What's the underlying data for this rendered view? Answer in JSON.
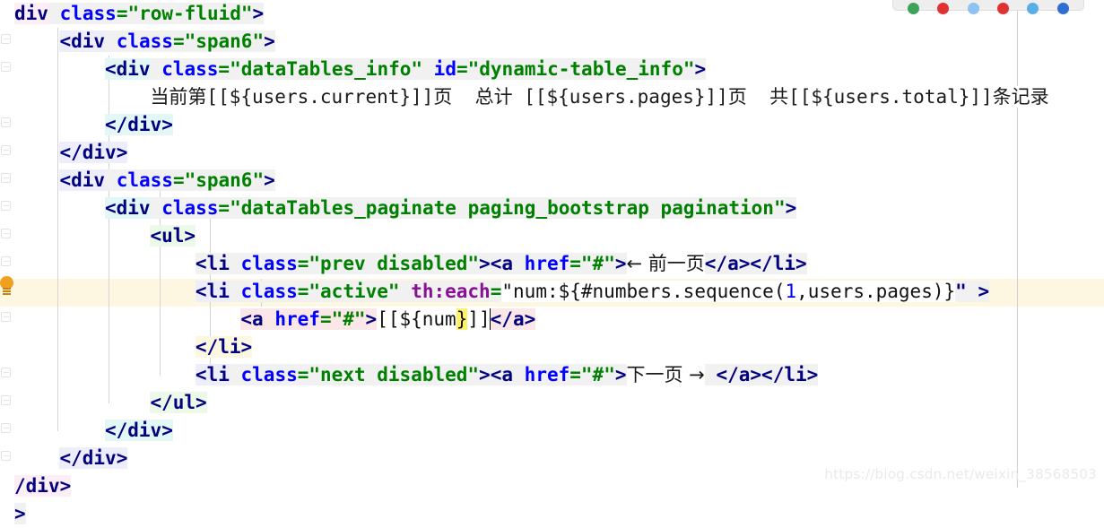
{
  "editor": {
    "title": "IntelliJ IDEA HTML/Thymeleaf template editor",
    "current_line_number": 11,
    "caret_line_index": 10,
    "colors": {
      "tag": "#000080",
      "attribute": "#0000ff",
      "attribute_value": "#008000",
      "namespaced_attribute": "#871094",
      "current_line_background": "#fdf6e0",
      "matching_brace_background": "#fdf06a",
      "background": "#ffffff",
      "guide": "#cfcfcf",
      "bulb": "#f0a01e"
    },
    "lines": [
      {
        "indent": 0,
        "tokens": [
          {
            "t": "div",
            "c": "tag",
            "bg": "bg-pink"
          },
          {
            "t": " ",
            "c": "plain",
            "bg": "bg-grey"
          },
          {
            "t": "class",
            "c": "attr",
            "bg": "bg-grey"
          },
          {
            "t": "=",
            "c": "eq",
            "bg": "bg-grey"
          },
          {
            "t": "\"row-fluid\"",
            "c": "val",
            "bg": "bg-grey"
          },
          {
            "t": ">",
            "c": "pct",
            "bg": "bg-grey"
          }
        ]
      },
      {
        "indent": 1,
        "tokens": [
          {
            "t": "<",
            "c": "pct",
            "bg": "bg-lav"
          },
          {
            "t": "div",
            "c": "tag",
            "bg": "bg-lav"
          },
          {
            "t": " ",
            "c": "plain",
            "bg": "bg-grey"
          },
          {
            "t": "class",
            "c": "attr",
            "bg": "bg-grey"
          },
          {
            "t": "=",
            "c": "eq",
            "bg": "bg-grey"
          },
          {
            "t": "\"span6\"",
            "c": "val",
            "bg": "bg-grey"
          },
          {
            "t": ">",
            "c": "pct",
            "bg": "bg-grey"
          }
        ]
      },
      {
        "indent": 2,
        "tokens": [
          {
            "t": "<",
            "c": "pct",
            "bg": "bg-cyan"
          },
          {
            "t": "div",
            "c": "tag",
            "bg": "bg-cyan"
          },
          {
            "t": " ",
            "c": "plain",
            "bg": "bg-grey"
          },
          {
            "t": "class",
            "c": "attr",
            "bg": "bg-grey"
          },
          {
            "t": "=",
            "c": "eq",
            "bg": "bg-grey"
          },
          {
            "t": "\"dataTables_info\"",
            "c": "val",
            "bg": "bg-grey"
          },
          {
            "t": " ",
            "c": "plain",
            "bg": "bg-grey"
          },
          {
            "t": "id",
            "c": "attr",
            "bg": "bg-grey"
          },
          {
            "t": "=",
            "c": "eq",
            "bg": "bg-grey"
          },
          {
            "t": "\"dynamic-table_info\"",
            "c": "val",
            "bg": "bg-grey"
          },
          {
            "t": ">",
            "c": "pct",
            "bg": "bg-grey"
          }
        ]
      },
      {
        "indent": 3,
        "cjk": true,
        "tokens": [
          {
            "t": "当前第[[${users.current}]]页  总计 [[${users.pages}]]页  共[[${users.total}]]条记录",
            "c": "plain",
            "bg": "bg-white"
          }
        ]
      },
      {
        "indent": 2,
        "tokens": [
          {
            "t": "</",
            "c": "pct",
            "bg": "bg-cyan"
          },
          {
            "t": "div",
            "c": "tag",
            "bg": "bg-cyan"
          },
          {
            "t": ">",
            "c": "pct",
            "bg": "bg-cyan"
          }
        ]
      },
      {
        "indent": 1,
        "tokens": [
          {
            "t": "</",
            "c": "pct",
            "bg": "bg-lav"
          },
          {
            "t": "div",
            "c": "tag",
            "bg": "bg-lav"
          },
          {
            "t": ">",
            "c": "pct",
            "bg": "bg-lav"
          }
        ]
      },
      {
        "indent": 1,
        "tokens": [
          {
            "t": "<",
            "c": "pct",
            "bg": "bg-lav"
          },
          {
            "t": "div",
            "c": "tag",
            "bg": "bg-lav"
          },
          {
            "t": " ",
            "c": "plain",
            "bg": "bg-grey"
          },
          {
            "t": "class",
            "c": "attr",
            "bg": "bg-grey"
          },
          {
            "t": "=",
            "c": "eq",
            "bg": "bg-grey"
          },
          {
            "t": "\"span6\"",
            "c": "val",
            "bg": "bg-grey"
          },
          {
            "t": ">",
            "c": "pct",
            "bg": "bg-grey"
          }
        ]
      },
      {
        "indent": 2,
        "tokens": [
          {
            "t": "<",
            "c": "pct",
            "bg": "bg-cyan"
          },
          {
            "t": "div",
            "c": "tag",
            "bg": "bg-cyan"
          },
          {
            "t": " ",
            "c": "plain",
            "bg": "bg-grey"
          },
          {
            "t": "class",
            "c": "attr",
            "bg": "bg-grey"
          },
          {
            "t": "=",
            "c": "eq",
            "bg": "bg-grey"
          },
          {
            "t": "\"dataTables_paginate paging_bootstrap pagination\"",
            "c": "val",
            "bg": "bg-grey"
          },
          {
            "t": ">",
            "c": "pct",
            "bg": "bg-grey"
          }
        ]
      },
      {
        "indent": 3,
        "tokens": [
          {
            "t": "<",
            "c": "pct",
            "bg": "bg-green"
          },
          {
            "t": "ul",
            "c": "tag",
            "bg": "bg-green"
          },
          {
            "t": ">",
            "c": "pct",
            "bg": "bg-green"
          }
        ]
      },
      {
        "indent": 4,
        "cjk_mix": true,
        "tokens": [
          {
            "t": "<",
            "c": "pct",
            "bg": "bg-grey"
          },
          {
            "t": "li",
            "c": "tag",
            "bg": "bg-grey"
          },
          {
            "t": " ",
            "c": "plain",
            "bg": "bg-grey"
          },
          {
            "t": "class",
            "c": "attr",
            "bg": "bg-grey"
          },
          {
            "t": "=",
            "c": "eq",
            "bg": "bg-grey"
          },
          {
            "t": "\"prev disabled\"",
            "c": "val",
            "bg": "bg-grey"
          },
          {
            "t": ">",
            "c": "pct",
            "bg": "bg-grey"
          },
          {
            "t": "<",
            "c": "pct",
            "bg": "bg-grey"
          },
          {
            "t": "a",
            "c": "tag",
            "bg": "bg-grey"
          },
          {
            "t": " ",
            "c": "plain",
            "bg": "bg-grey"
          },
          {
            "t": "href",
            "c": "attr",
            "bg": "bg-grey"
          },
          {
            "t": "=",
            "c": "eq",
            "bg": "bg-grey"
          },
          {
            "t": "\"#\"",
            "c": "val",
            "bg": "bg-grey"
          },
          {
            "t": ">",
            "c": "pct",
            "bg": "bg-grey"
          },
          {
            "t": "← 前一页",
            "c": "cjk",
            "bg": "bg-white"
          },
          {
            "t": "</",
            "c": "pct",
            "bg": "bg-grey"
          },
          {
            "t": "a",
            "c": "tag",
            "bg": "bg-grey"
          },
          {
            "t": ">",
            "c": "pct",
            "bg": "bg-grey"
          },
          {
            "t": "</",
            "c": "pct",
            "bg": "bg-grey"
          },
          {
            "t": "li",
            "c": "tag",
            "bg": "bg-grey"
          },
          {
            "t": ">",
            "c": "pct",
            "bg": "bg-grey"
          }
        ]
      },
      {
        "indent": 4,
        "tokens": [
          {
            "t": "<",
            "c": "pct",
            "bg": "bg-lav"
          },
          {
            "t": "li",
            "c": "tag",
            "bg": "bg-lav"
          },
          {
            "t": " ",
            "c": "plain",
            "bg": "bg-grey"
          },
          {
            "t": "class",
            "c": "attr",
            "bg": "bg-grey"
          },
          {
            "t": "=",
            "c": "eq",
            "bg": "bg-grey"
          },
          {
            "t": "\"active\"",
            "c": "val",
            "bg": "bg-grey"
          },
          {
            "t": " ",
            "c": "plain",
            "bg": "bg-grey"
          },
          {
            "t": "th:each",
            "c": "th",
            "bg": "bg-grey"
          },
          {
            "t": "=",
            "c": "eq",
            "bg": "bg-grey"
          },
          {
            "t": "\"",
            "c": "dark",
            "bg": "bg-white"
          },
          {
            "t": "num:${#numbers.sequence(",
            "c": "dark",
            "bg": "bg-white"
          },
          {
            "t": "1",
            "c": "num",
            "bg": "bg-white"
          },
          {
            "t": ",users.pages)}",
            "c": "dark",
            "bg": "bg-white"
          },
          {
            "t": "\"",
            "c": "pct",
            "bg": "bg-grey"
          },
          {
            "t": " ",
            "c": "plain",
            "bg": "bg-grey"
          },
          {
            "t": ">",
            "c": "pct",
            "bg": "bg-grey"
          }
        ]
      },
      {
        "indent": 5,
        "current": true,
        "caret_after": "]]",
        "tokens": [
          {
            "t": "<",
            "c": "pct",
            "bg": "bg-rose"
          },
          {
            "t": "a",
            "c": "tag",
            "bg": "bg-rose"
          },
          {
            "t": " ",
            "c": "plain",
            "bg": "bg-rose"
          },
          {
            "t": "href",
            "c": "attr",
            "bg": "bg-rose"
          },
          {
            "t": "=",
            "c": "eq",
            "bg": "bg-rose"
          },
          {
            "t": "\"#\"",
            "c": "val",
            "bg": "bg-rose"
          },
          {
            "t": ">",
            "c": "pct",
            "bg": "bg-rose"
          },
          {
            "t": "[[${num",
            "c": "dark",
            "bg": "bg-white"
          },
          {
            "t": "}",
            "c": "dark",
            "bg": "brace-hl"
          },
          {
            "t": "]]",
            "c": "dark",
            "bg": "bg-white"
          },
          {
            "t": "CARET",
            "c": "caret",
            "bg": "bg-white"
          },
          {
            "t": "</",
            "c": "pct",
            "bg": "bg-rose"
          },
          {
            "t": "a",
            "c": "tag",
            "bg": "bg-rose"
          },
          {
            "t": ">",
            "c": "pct",
            "bg": "bg-rose"
          }
        ]
      },
      {
        "indent": 4,
        "tokens": [
          {
            "t": "</",
            "c": "pct",
            "bg": "bg-yellow"
          },
          {
            "t": "li",
            "c": "tag",
            "bg": "bg-yellow"
          },
          {
            "t": ">",
            "c": "pct",
            "bg": "bg-yellow"
          }
        ]
      },
      {
        "indent": 4,
        "cjk_mix": true,
        "tokens": [
          {
            "t": "<",
            "c": "pct",
            "bg": "bg-lav"
          },
          {
            "t": "li",
            "c": "tag",
            "bg": "bg-lav"
          },
          {
            "t": " ",
            "c": "plain",
            "bg": "bg-grey"
          },
          {
            "t": "class",
            "c": "attr",
            "bg": "bg-grey"
          },
          {
            "t": "=",
            "c": "eq",
            "bg": "bg-grey"
          },
          {
            "t": "\"next disabled\"",
            "c": "val",
            "bg": "bg-grey"
          },
          {
            "t": ">",
            "c": "pct",
            "bg": "bg-grey"
          },
          {
            "t": "<",
            "c": "pct",
            "bg": "bg-grey"
          },
          {
            "t": "a",
            "c": "tag",
            "bg": "bg-grey"
          },
          {
            "t": " ",
            "c": "plain",
            "bg": "bg-grey"
          },
          {
            "t": "href",
            "c": "attr",
            "bg": "bg-grey"
          },
          {
            "t": "=",
            "c": "eq",
            "bg": "bg-grey"
          },
          {
            "t": "\"#\"",
            "c": "val",
            "bg": "bg-grey"
          },
          {
            "t": ">",
            "c": "pct",
            "bg": "bg-grey"
          },
          {
            "t": "下一页 →",
            "c": "cjk",
            "bg": "bg-white"
          },
          {
            "t": " ",
            "c": "plain",
            "bg": "bg-grey"
          },
          {
            "t": "</",
            "c": "pct",
            "bg": "bg-grey"
          },
          {
            "t": "a",
            "c": "tag",
            "bg": "bg-grey"
          },
          {
            "t": ">",
            "c": "pct",
            "bg": "bg-grey"
          },
          {
            "t": "</",
            "c": "pct",
            "bg": "bg-grey"
          },
          {
            "t": "li",
            "c": "tag",
            "bg": "bg-grey"
          },
          {
            "t": ">",
            "c": "pct",
            "bg": "bg-grey"
          }
        ]
      },
      {
        "indent": 3,
        "tokens": [
          {
            "t": "</",
            "c": "pct",
            "bg": "bg-green"
          },
          {
            "t": "ul",
            "c": "tag",
            "bg": "bg-green"
          },
          {
            "t": ">",
            "c": "pct",
            "bg": "bg-green"
          }
        ]
      },
      {
        "indent": 2,
        "tokens": [
          {
            "t": "</",
            "c": "pct",
            "bg": "bg-cyan"
          },
          {
            "t": "div",
            "c": "tag",
            "bg": "bg-cyan"
          },
          {
            "t": ">",
            "c": "pct",
            "bg": "bg-cyan"
          }
        ]
      },
      {
        "indent": 1,
        "tokens": [
          {
            "t": "</",
            "c": "pct",
            "bg": "bg-lav"
          },
          {
            "t": "div",
            "c": "tag",
            "bg": "bg-lav"
          },
          {
            "t": ">",
            "c": "pct",
            "bg": "bg-lav"
          }
        ]
      },
      {
        "indent": 0,
        "tokens": [
          {
            "t": "/",
            "c": "pct",
            "bg": "bg-pink"
          },
          {
            "t": "div",
            "c": "tag",
            "bg": "bg-pink"
          },
          {
            "t": ">",
            "c": "pct",
            "bg": "bg-pink"
          }
        ]
      },
      {
        "indent": 0,
        "tokens": [
          {
            "t": ">",
            "c": "pct",
            "bg": "bg-grey"
          }
        ]
      }
    ]
  },
  "toolbar": {
    "label": "floating-action-toolbar",
    "dots": [
      "#3ea35a",
      "#e03232",
      "#8ec2f0",
      "#e03232",
      "#5aaee8",
      "#2f6fd0"
    ]
  },
  "watermark": {
    "text": "https://blog.csdn.net/weixin_38568503"
  }
}
